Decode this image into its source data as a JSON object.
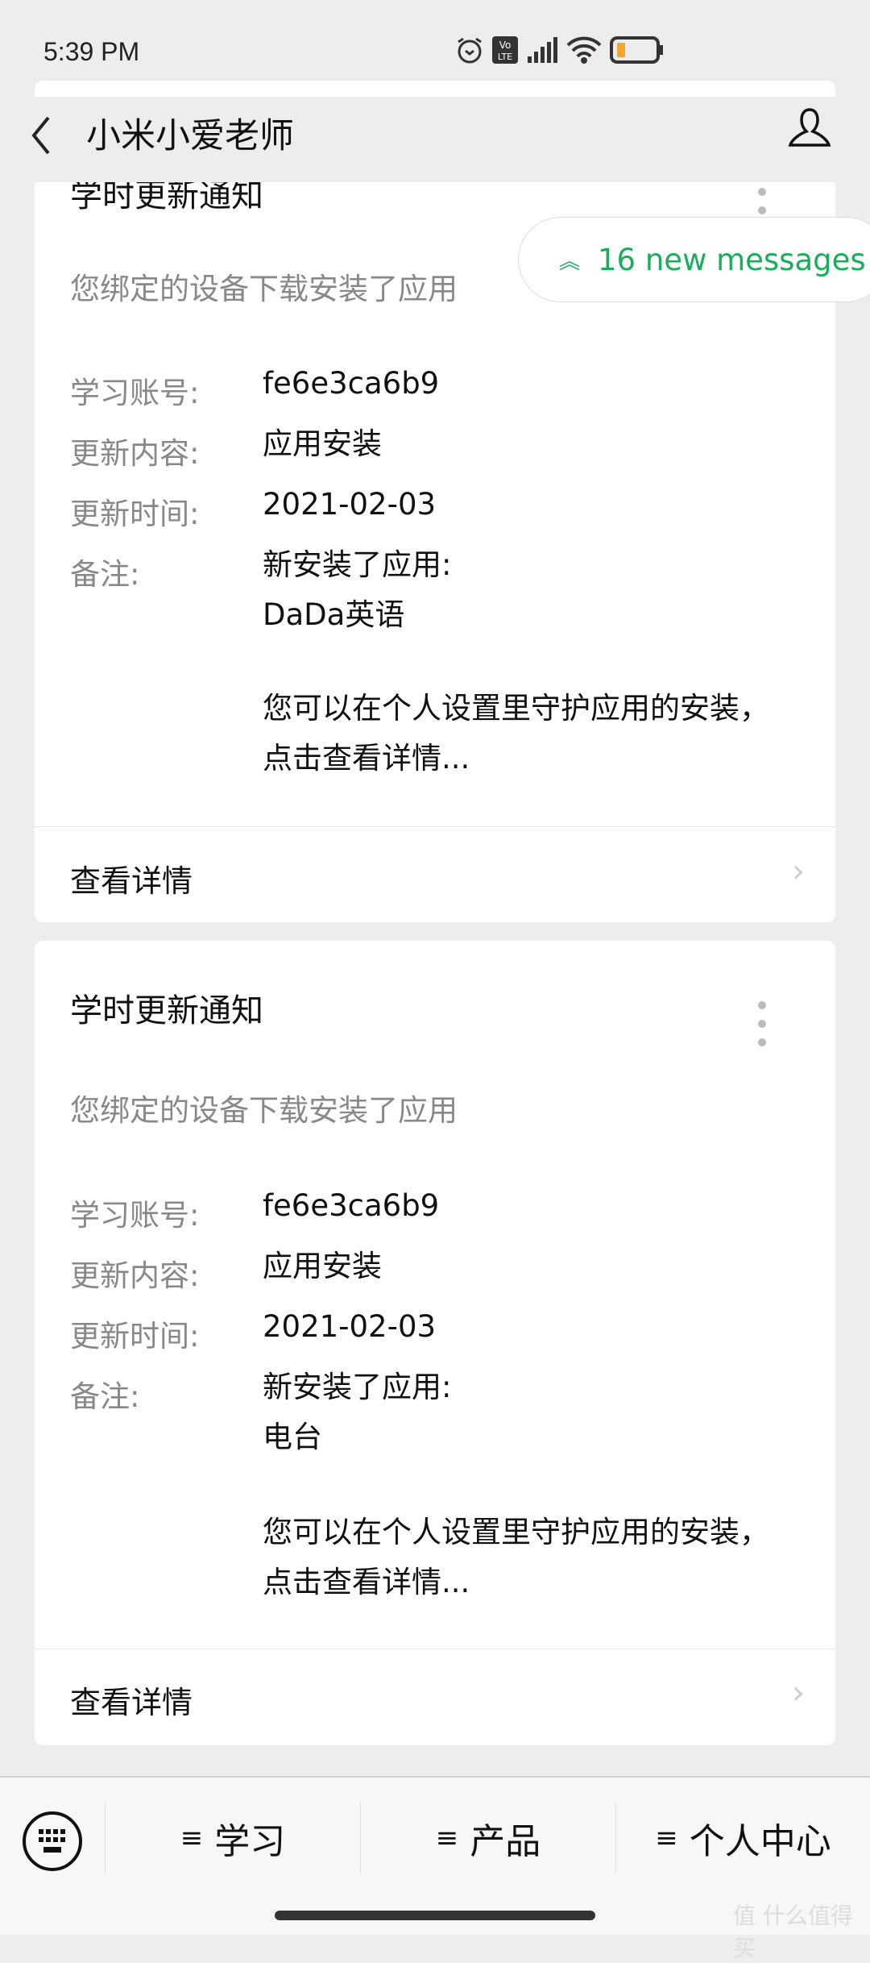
{
  "status": {
    "time": "5:39 PM",
    "battery_color": "#f0a830"
  },
  "header": {
    "title": "小米小爱老师",
    "back_icon": "chevron-left",
    "profile_icon": "person"
  },
  "new_messages": {
    "label": "16 new messages",
    "color": "#1aad5a"
  },
  "cards": [
    {
      "title": "学时更新通知",
      "subtitle": "您绑定的设备下载安装了应用",
      "rows": [
        {
          "label": "学习账号:",
          "value": "fe6e3ca6b9"
        },
        {
          "label": "更新内容:",
          "value": "应用安装"
        },
        {
          "label": "更新时间:",
          "value": "2021-02-03"
        },
        {
          "label": "备注:",
          "value": "新安装了应用:",
          "value2": "DaDa英语"
        }
      ],
      "note": "您可以在个人设置里守护应用的安装，点击查看详情...",
      "link": "查看详情"
    },
    {
      "title": "学时更新通知",
      "subtitle": "您绑定的设备下载安装了应用",
      "rows": [
        {
          "label": "学习账号:",
          "value": "fe6e3ca6b9"
        },
        {
          "label": "更新内容:",
          "value": "应用安装"
        },
        {
          "label": "更新时间:",
          "value": "2021-02-03"
        },
        {
          "label": "备注:",
          "value": "新安装了应用:",
          "value2": "电台"
        }
      ],
      "note": "您可以在个人设置里守护应用的安装，点击查看详情...",
      "link": "查看详情"
    }
  ],
  "bottom_menu": {
    "items": [
      {
        "label": "学习"
      },
      {
        "label": "产品"
      },
      {
        "label": "个人中心"
      }
    ],
    "menu_glyph": "≡"
  },
  "watermark": "值 什么值得买"
}
